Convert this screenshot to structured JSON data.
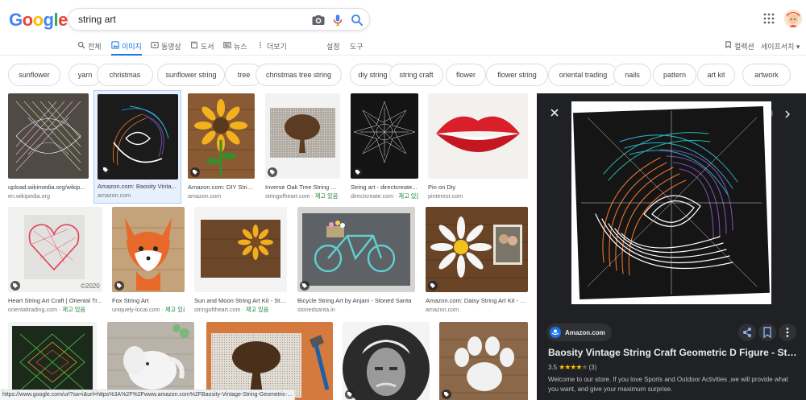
{
  "header": {
    "logo_letters": [
      {
        "ch": "G",
        "color": "#4285F4"
      },
      {
        "ch": "o",
        "color": "#EA4335"
      },
      {
        "ch": "o",
        "color": "#FBBC05"
      },
      {
        "ch": "g",
        "color": "#4285F4"
      },
      {
        "ch": "l",
        "color": "#34A853"
      },
      {
        "ch": "e",
        "color": "#EA4335"
      }
    ],
    "search_value": "string art",
    "icons": [
      "camera-icon",
      "mic-icon",
      "search-icon",
      "apps-grid-icon"
    ]
  },
  "tabs": {
    "items": [
      {
        "label": "전체",
        "icon": "search-icon",
        "active": false
      },
      {
        "label": "이미지",
        "icon": "image-icon",
        "active": true
      },
      {
        "label": "동영상",
        "icon": "video-icon",
        "active": false
      },
      {
        "label": "도서",
        "icon": "book-icon",
        "active": false
      },
      {
        "label": "뉴스",
        "icon": "news-icon",
        "active": false
      },
      {
        "label": "더보기",
        "icon": "more-vert-icon",
        "active": false
      }
    ],
    "settings_label": "설정",
    "tools_label": "도구",
    "collections_label": "컬렉션",
    "safesearch_label": "세이프서치 ▾"
  },
  "chips": [
    "sunflower",
    "yarn",
    "christmas",
    "sunflower string",
    "tree",
    "christmas tree string",
    "diy string",
    "string craft",
    "flower",
    "flower string",
    "oriental trading",
    "nails",
    "pattern",
    "art kit",
    "artwork"
  ],
  "results": {
    "stock_label": "재고 있음",
    "row1": [
      {
        "title": "upload.wikimedia.org/wikip...",
        "source": "en.wikipedia.org",
        "stock": false
      },
      {
        "title": "Amazon.com: Baosity Vinta...",
        "source": "amazon.com",
        "stock": false
      },
      {
        "title": "Amazon.com: DIY Strin...",
        "source": "amazon.com",
        "stock": false
      },
      {
        "title": "Inverse Oak Tree String Ar...",
        "source": "stringofheart.com",
        "stock": true
      },
      {
        "title": "String art - directcreate...",
        "source": "directcreate.com",
        "stock": true
      },
      {
        "title": "Pin on Diy",
        "source": "pinterest.com",
        "stock": false
      }
    ],
    "row2": [
      {
        "title": "Heart String Art Craft | Oriental Tr...",
        "source": "orientaltrading.com",
        "stock": true,
        "watermark": "©2020"
      },
      {
        "title": "Fox String Art",
        "source": "uniquely-local.com",
        "stock": true
      },
      {
        "title": "Sun and Moon String Art Kit - Stri...",
        "source": "stringoftheart.com",
        "stock": true
      },
      {
        "title": "Bicycle String Art by Anjani - Stoned Santa",
        "source": "stonedsanta.in",
        "stock": false
      },
      {
        "title": "Amazon.com: Daisy String Art Kit - S...",
        "source": "amazon.com",
        "stock": false
      }
    ]
  },
  "panel": {
    "site": "Amazon.com",
    "title": "Baosity Vintage String Craft Geometric D Figure - String A...",
    "rating_value": "3.5",
    "rating_stars": "★★★★",
    "rating_count": "(3)",
    "description": "Welcome to our store. If you love Sports and Outdoor Activities ,we will provide what you want, and give your maximum surprise."
  },
  "status_url": "https://www.google.com/url?sa=i&url=https%3A%2F%2Fwww.amazon.com%2FBaosity-Vintage-String-Geometric-..."
}
